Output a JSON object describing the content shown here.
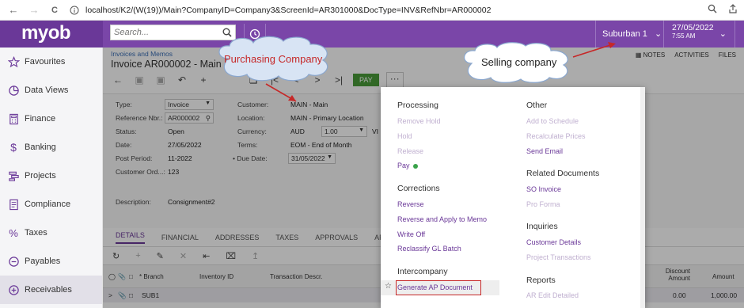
{
  "browser": {
    "back": "←",
    "forward": "→",
    "reload": "C",
    "url": "localhost/K2/(W(19))/Main?CompanyID=Company3&ScreenId=AR301000&DocType=INV&RefNbr=AR000002"
  },
  "header": {
    "logo": "myob",
    "search_placeholder": "Search...",
    "branch": "Suburban 1",
    "date": "27/05/2022",
    "time": "7:55 AM",
    "accent": "#7a46a8"
  },
  "sidebar": {
    "items": [
      {
        "label": "Favourites",
        "icon": "star-icon"
      },
      {
        "label": "Data Views",
        "icon": "pie-chart-icon"
      },
      {
        "label": "Finance",
        "icon": "calculator-icon"
      },
      {
        "label": "Banking",
        "icon": "dollar-icon"
      },
      {
        "label": "Projects",
        "icon": "projects-icon"
      },
      {
        "label": "Compliance",
        "icon": "compliance-icon"
      },
      {
        "label": "Taxes",
        "icon": "percent-icon"
      },
      {
        "label": "Payables",
        "icon": "minus-circle-icon"
      },
      {
        "label": "Receivables",
        "icon": "plus-circle-icon"
      }
    ]
  },
  "page": {
    "breadcrumb": "Invoices and Memos",
    "title": "Invoice AR000002 - Main",
    "links": [
      "NOTES",
      "ACTIVITIES",
      "FILES"
    ],
    "pay_button": "PAY",
    "more_button": "···"
  },
  "form": {
    "type_label": "Type:",
    "type_value": "Invoice",
    "ref_label": "Reference Nbr.:",
    "ref_value": "AR000002",
    "status_label": "Status:",
    "status_value": "Open",
    "date_label": "Date:",
    "date_value": "27/05/2022",
    "period_label": "Post Period:",
    "period_value": "11-2022",
    "custord_label": "Customer Ord...:",
    "custord_value": "123",
    "customer_label": "Customer:",
    "customer_value": "MAIN - Main",
    "location_label": "Location:",
    "location_value": "MAIN - Primary Location",
    "currency_label": "Currency:",
    "currency_value": "AUD",
    "rate_value": "1.00",
    "rate_suffix": "VI",
    "terms_label": "Terms:",
    "terms_value": "EOM - End of Month",
    "duedate_label": "• Due Date:",
    "duedate_value": "31/05/2022",
    "desc_label": "Description:",
    "desc_value": "Consignment#2"
  },
  "tabs": [
    "DETAILS",
    "FINANCIAL",
    "ADDRESSES",
    "TAXES",
    "APPROVALS",
    "APPLICA"
  ],
  "grid": {
    "headers": {
      "branch": "* Branch",
      "inventory": "Inventory ID",
      "txn": "Transaction Descr.",
      "discount1": "Discount",
      "discount2": "Amount",
      "amount": "Amount"
    },
    "row": {
      "branch": "SUB1",
      "discount": "0.00",
      "amount": "1,000.00"
    }
  },
  "menu": {
    "processing": {
      "title": "Processing",
      "items": [
        "Remove Hold",
        "Hold",
        "Release",
        "Pay"
      ]
    },
    "corrections": {
      "title": "Corrections",
      "items": [
        "Reverse",
        "Reverse and Apply to Memo",
        "Write Off",
        "Reclassify GL Batch"
      ]
    },
    "intercompany": {
      "title": "Intercompany",
      "items": [
        "Generate AP Document"
      ]
    },
    "other": {
      "title": "Other",
      "items": [
        "Add to Schedule",
        "Recalculate Prices",
        "Send Email"
      ]
    },
    "related": {
      "title": "Related Documents",
      "items": [
        "SO Invoice",
        "Pro Forma"
      ]
    },
    "inquiries": {
      "title": "Inquiries",
      "items": [
        "Customer Details",
        "Project Transactions"
      ]
    },
    "reports": {
      "title": "Reports",
      "items": [
        "AR Edit Detailed"
      ]
    }
  },
  "callouts": {
    "purchasing": "Purchasing Company",
    "selling": "Selling company"
  }
}
